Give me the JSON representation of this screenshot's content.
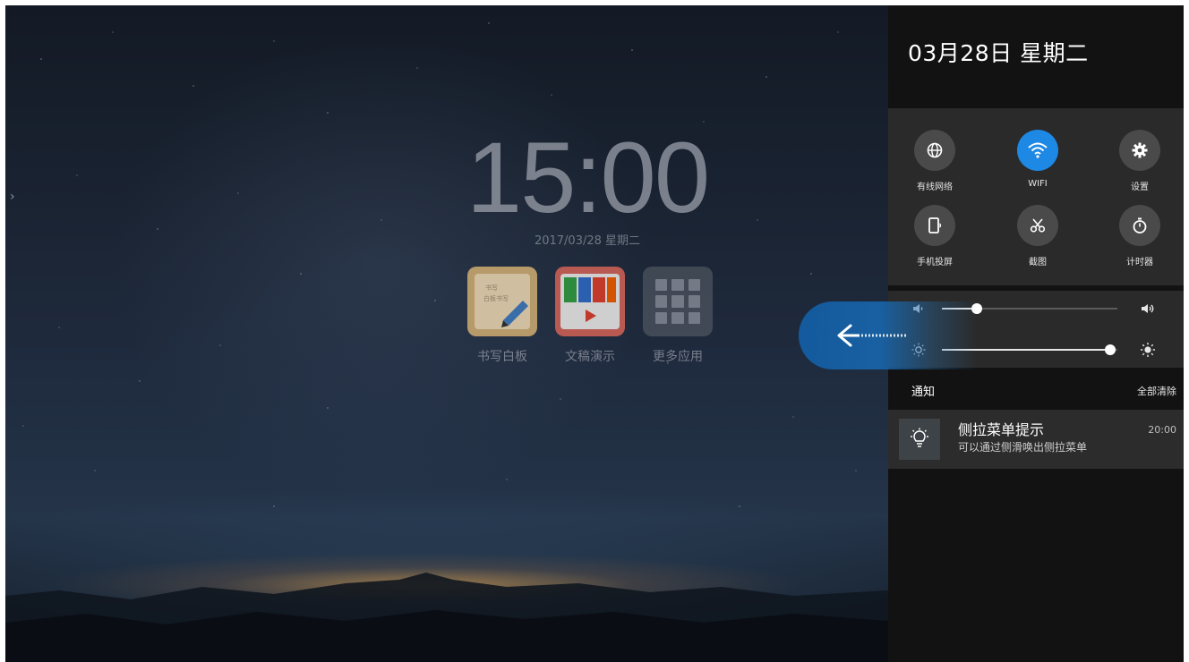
{
  "home": {
    "time": "15:00",
    "date": "2017/03/28  星期二",
    "edge_arrow": "›",
    "apps": [
      {
        "label": "书写白板",
        "icon": "whiteboard-icon"
      },
      {
        "label": "文稿演示",
        "icon": "presentation-icon"
      },
      {
        "label": "更多应用",
        "icon": "app-grid-icon"
      }
    ],
    "whiteboard_scribble": [
      "书写",
      "白板书写"
    ]
  },
  "panel": {
    "date": "03月28日 星期二",
    "quick_settings": [
      {
        "label": "有线网络",
        "icon": "globe-icon",
        "active": false
      },
      {
        "label": "WIFI",
        "icon": "wifi-icon",
        "active": true
      },
      {
        "label": "设置",
        "icon": "gear-icon",
        "active": false
      },
      {
        "label": "手机投屏",
        "icon": "phone-cast-icon",
        "active": false
      },
      {
        "label": "截图",
        "icon": "scissors-icon",
        "active": false
      },
      {
        "label": "计时器",
        "icon": "stopwatch-icon",
        "active": false
      }
    ],
    "volume": {
      "level": 0.2,
      "icon_low": "volume-low-icon",
      "icon_high": "volume-high-icon"
    },
    "brightness": {
      "level": 0.96,
      "icon_low": "brightness-low-icon",
      "icon_high": "brightness-high-icon"
    },
    "notifications": {
      "title": "通知",
      "clear_all": "全部清除",
      "items": [
        {
          "title": "侧拉菜单提示",
          "body": "可以通过侧滑唤出侧拉菜单",
          "time": "20:00",
          "icon": "lightbulb-icon"
        }
      ]
    }
  },
  "swipe_hint": {
    "icon": "arrow-left-icon"
  },
  "colors": {
    "accent": "#1e88e5",
    "panel_bg": "#121212",
    "tile_bg": "#2a2a2a",
    "swipe_blue": "#135ba0"
  }
}
